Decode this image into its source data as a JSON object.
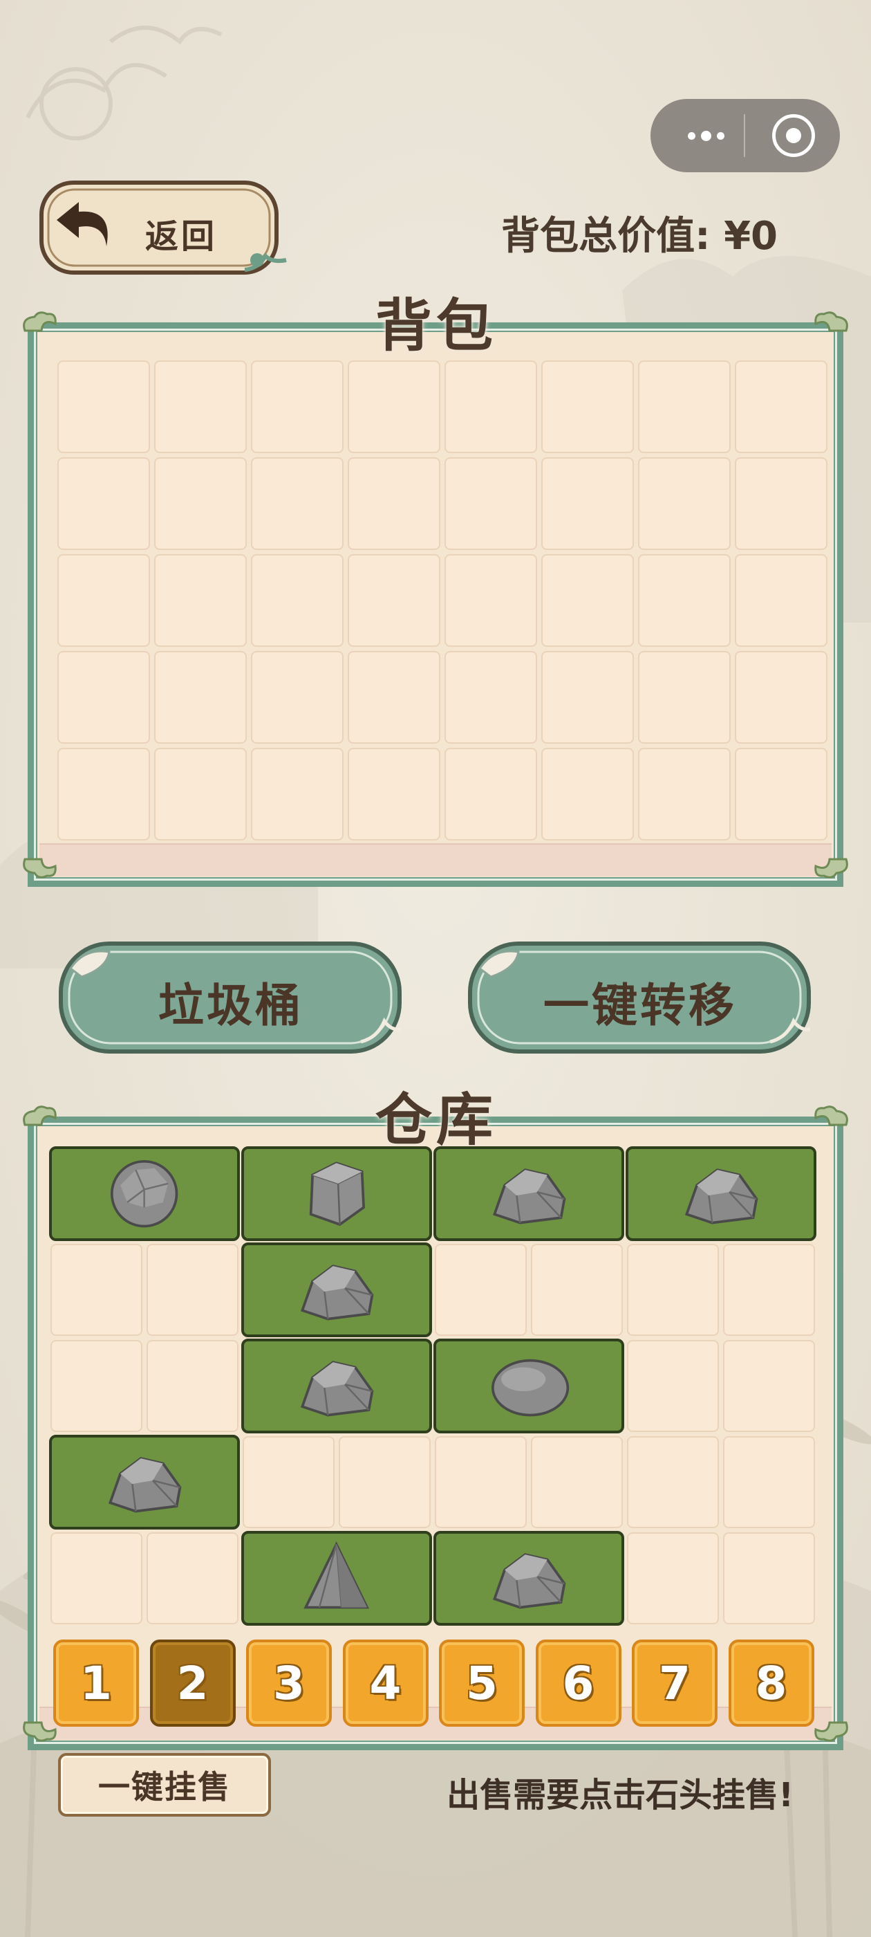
{
  "top_bar": {
    "menu_icon": "more-dots-icon",
    "close_icon": "target-circle-icon",
    "back_label": "返回",
    "back_icon": "back-arrow-icon",
    "total_value_label": "背包总价值: ¥0"
  },
  "backpack": {
    "title": "背包",
    "rows": 5,
    "cols": 8
  },
  "actions": {
    "trash_label": "垃圾桶",
    "transfer_label": "一键转移"
  },
  "warehouse": {
    "title": "仓库",
    "rows": 5,
    "cols": 8,
    "items": [
      {
        "row": 0,
        "col": 0,
        "w": 2,
        "h": 1,
        "stone": "round-stone-icon"
      },
      {
        "row": 0,
        "col": 2,
        "w": 2,
        "h": 1,
        "stone": "cube-stone-icon"
      },
      {
        "row": 0,
        "col": 4,
        "w": 2,
        "h": 1,
        "stone": "rock-stone-icon"
      },
      {
        "row": 0,
        "col": 6,
        "w": 2,
        "h": 1,
        "stone": "rock-stone-icon"
      },
      {
        "row": 1,
        "col": 2,
        "w": 2,
        "h": 1,
        "stone": "rock-stone-icon"
      },
      {
        "row": 2,
        "col": 2,
        "w": 2,
        "h": 1,
        "stone": "rock-stone-icon"
      },
      {
        "row": 2,
        "col": 4,
        "w": 2,
        "h": 1,
        "stone": "oval-stone-icon"
      },
      {
        "row": 3,
        "col": 0,
        "w": 2,
        "h": 1,
        "stone": "rock-stone-icon"
      },
      {
        "row": 4,
        "col": 2,
        "w": 2,
        "h": 1,
        "stone": "pyramid-stone-icon"
      },
      {
        "row": 4,
        "col": 4,
        "w": 2,
        "h": 1,
        "stone": "rock-stone-icon"
      }
    ],
    "tabs": [
      "1",
      "2",
      "3",
      "4",
      "5",
      "6",
      "7",
      "8"
    ],
    "active_tab": 1
  },
  "footer": {
    "sell_all_label": "一键挂售",
    "hint": "出售需要点击石头挂售!"
  },
  "colors": {
    "panel_border": "#6e9e88",
    "cell": "#fae9d4",
    "item_green": "#6e9441",
    "tab_orange": "#f2a72c",
    "tab_active": "#a36f19"
  }
}
